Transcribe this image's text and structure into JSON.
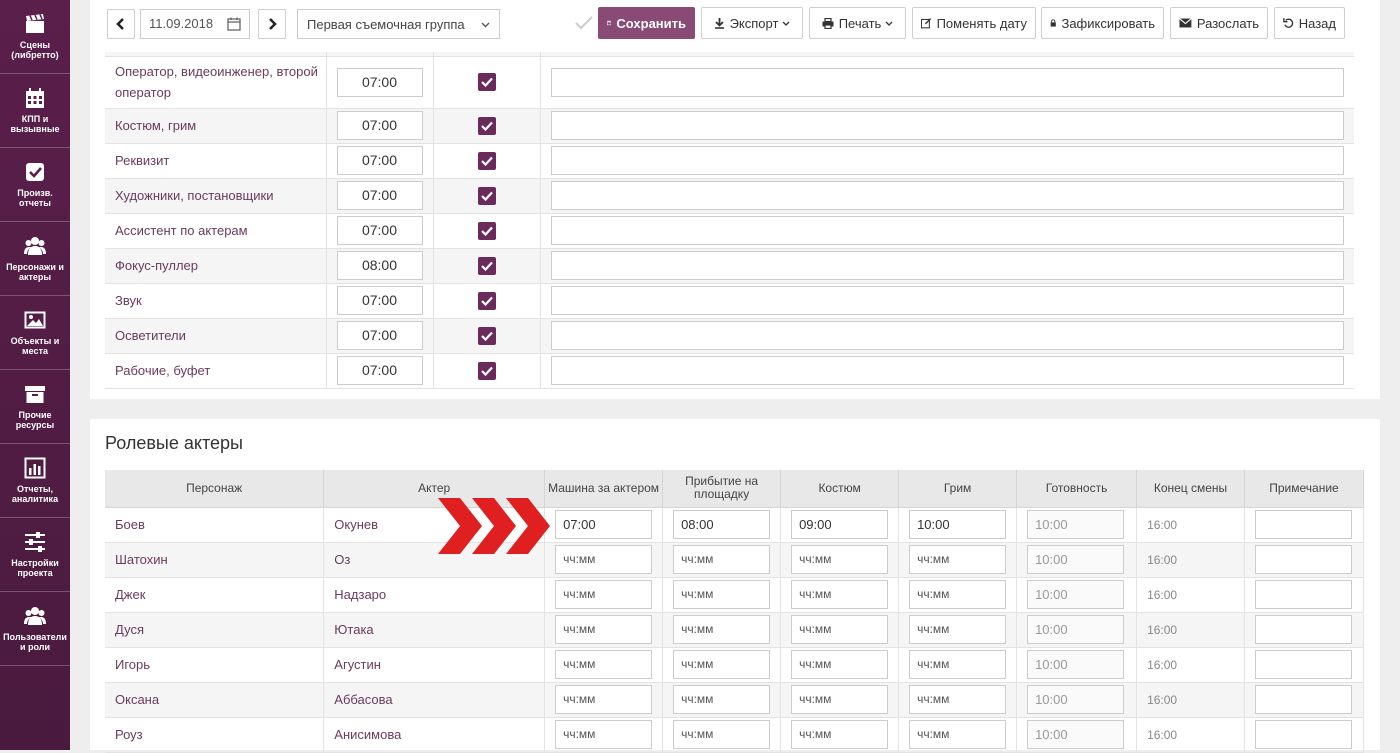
{
  "sidebar": {
    "items": [
      {
        "label": "Сцены (либретто)",
        "icon": "clapperboard-icon"
      },
      {
        "label": "КПП и вызывные",
        "icon": "calendar-icon"
      },
      {
        "label": "Произв. отчеты",
        "icon": "checkbox-icon"
      },
      {
        "label": "Персонажи и актеры",
        "icon": "users-icon"
      },
      {
        "label": "Объекты и места",
        "icon": "image-icon"
      },
      {
        "label": "Прочие ресурсы",
        "icon": "archive-icon"
      },
      {
        "label": "Отчеты, аналитика",
        "icon": "bar-chart-icon"
      },
      {
        "label": "Настройки проекта",
        "icon": "sliders-icon"
      },
      {
        "label": "Пользователи и роли",
        "icon": "users-icon"
      }
    ]
  },
  "toolbar": {
    "date": "11.09.2018",
    "group": "Первая съемочная группа",
    "save": "Сохранить",
    "export": "Экспорт",
    "print": "Печать",
    "change_date": "Поменять дату",
    "fix": "Зафиксировать",
    "send": "Разослать",
    "back": "Назад"
  },
  "crew": {
    "rows": [
      {
        "dept": "Оператор, видеоинженер, второй оператор",
        "time": "07:00"
      },
      {
        "dept": "Костюм, грим",
        "time": "07:00"
      },
      {
        "dept": "Реквизит",
        "time": "07:00"
      },
      {
        "dept": "Художники, постановщики",
        "time": "07:00"
      },
      {
        "dept": "Ассистент по актерам",
        "time": "07:00"
      },
      {
        "dept": "Фокус-пуллер",
        "time": "08:00"
      },
      {
        "dept": "Звук",
        "time": "07:00"
      },
      {
        "dept": "Осветители",
        "time": "07:00"
      },
      {
        "dept": "Рабочие, буфет",
        "time": "07:00"
      }
    ]
  },
  "cast": {
    "title": "Ролевые актеры",
    "headers": [
      "Персонаж",
      "Актер",
      "Машина за актером",
      "Прибытие на площадку",
      "Костюм",
      "Грим",
      "Готовность",
      "Конец смены",
      "Примечание"
    ],
    "placeholder": "чч:мм",
    "rows": [
      {
        "role": "Боев",
        "actor": "Окунев",
        "car": "07:00",
        "arrival": "08:00",
        "costume": "09:00",
        "makeup": "10:00",
        "ready": "10:00",
        "end": "16:00"
      },
      {
        "role": "Шатохин",
        "actor": "Оз",
        "car": "",
        "arrival": "",
        "costume": "",
        "makeup": "",
        "ready": "10:00",
        "end": "16:00"
      },
      {
        "role": "Джек",
        "actor": "Надзаро",
        "car": "",
        "arrival": "",
        "costume": "",
        "makeup": "",
        "ready": "10:00",
        "end": "16:00"
      },
      {
        "role": "Дуся",
        "actor": "Ютака",
        "car": "",
        "arrival": "",
        "costume": "",
        "makeup": "",
        "ready": "10:00",
        "end": "16:00"
      },
      {
        "role": "Игорь",
        "actor": "Агустин",
        "car": "",
        "arrival": "",
        "costume": "",
        "makeup": "",
        "ready": "10:00",
        "end": "16:00"
      },
      {
        "role": "Оксана",
        "actor": "Аббасова",
        "car": "",
        "arrival": "",
        "costume": "",
        "makeup": "",
        "ready": "10:00",
        "end": "16:00"
      },
      {
        "role": "Роуз",
        "actor": "Анисимова",
        "car": "",
        "arrival": "",
        "costume": "",
        "makeup": "",
        "ready": "10:00",
        "end": "16:00"
      }
    ]
  },
  "colors": {
    "sidebar": "#5a1f4b",
    "accent": "#8a4a76",
    "checkbox": "#6a2a5c",
    "arrow": "#e02020"
  }
}
